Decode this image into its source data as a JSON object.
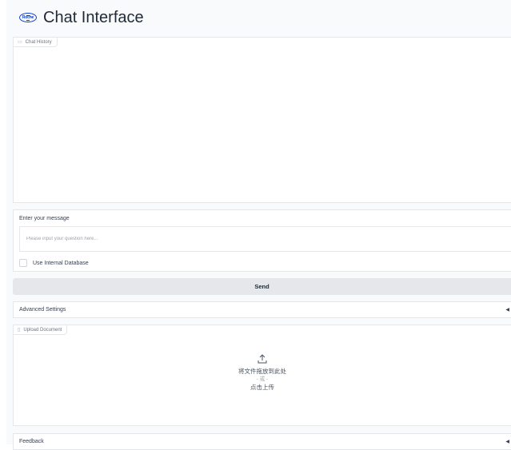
{
  "header": {
    "logo_text": "Roche",
    "title": "Chat Interface"
  },
  "chat_history": {
    "label": "Chat History",
    "icon": "chat-bubble-icon"
  },
  "message": {
    "label": "Enter your message",
    "placeholder": "Please input your question here...",
    "value": ""
  },
  "internal_db": {
    "label": "Use Internal Database",
    "checked": false
  },
  "send": {
    "label": "Send"
  },
  "advanced_settings": {
    "label": "Advanced Settings",
    "caret": "◀"
  },
  "upload": {
    "label": "Upload Document",
    "icon": "file-icon",
    "drop_text": "将文件拖放到此处",
    "or_text": "- 或 -",
    "click_text": "点击上传"
  },
  "feedback": {
    "label": "Feedback",
    "caret": "◀"
  },
  "colors": {
    "brand": "#0b41cd",
    "button_bg": "#e5e7eb",
    "border": "#e5e7eb"
  }
}
